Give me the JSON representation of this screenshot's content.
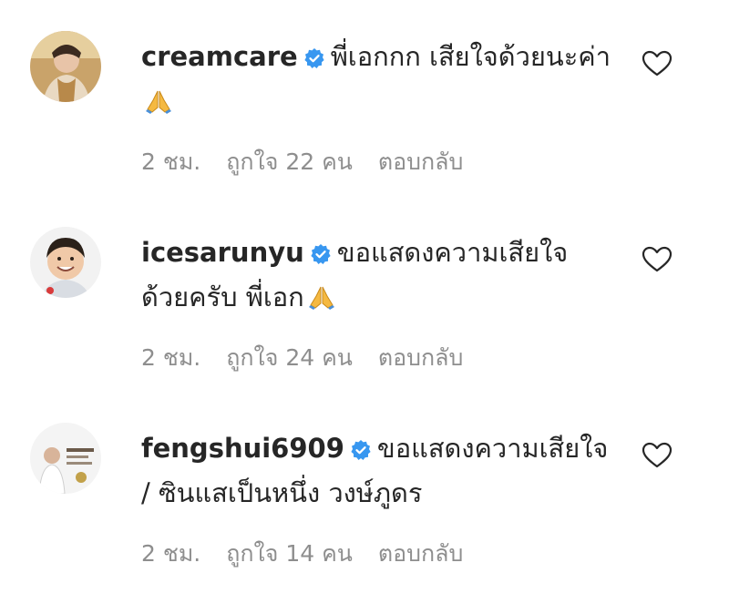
{
  "comments": [
    {
      "username": "creamcare",
      "text": "พี่เอกกก เสียใจด้วยนะค่า",
      "emoji": "folded-hands",
      "time": "2 ชม.",
      "likes": "ถูกใจ 22 คน",
      "reply": "ตอบกลับ"
    },
    {
      "username": "icesarunyu",
      "text": "ขอแสดงความเสียใจด้วยครับ พี่เอก",
      "emoji": "folded-hands",
      "time": "2 ชม.",
      "likes": "ถูกใจ 24 คน",
      "reply": "ตอบกลับ"
    },
    {
      "username": "fengshui6909",
      "text": "ขอแสดงความเสียใจ / ซินแสเป็นหนึ่ง วงษ์ภูดร",
      "time": "2 ชม.",
      "likes": "ถูกใจ 14 คน",
      "reply": "ตอบกลับ"
    }
  ],
  "colors": {
    "verified": "#3897f0",
    "meta_text": "#8e8e8e",
    "text": "#262626"
  },
  "icons": {
    "verified": "verified-badge-icon",
    "like": "heart-outline-icon",
    "emoji": "folded-hands-icon"
  }
}
